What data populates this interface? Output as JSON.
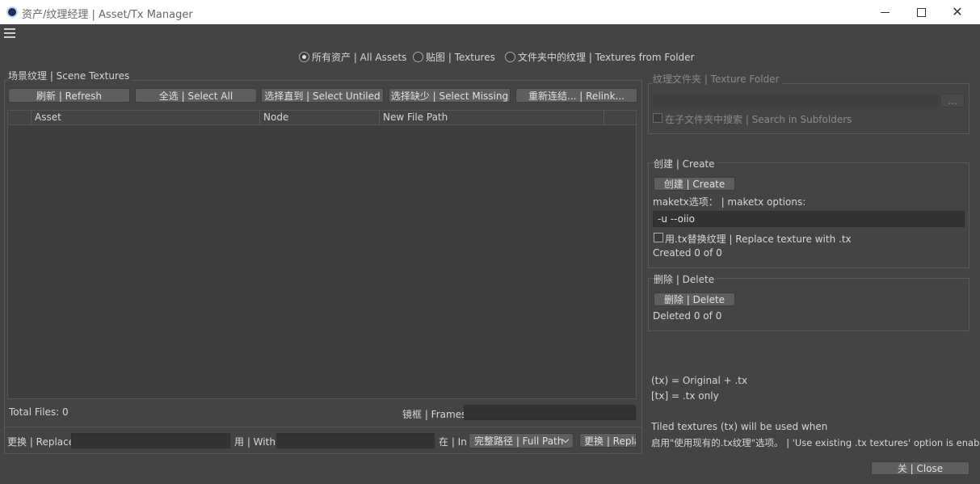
{
  "window": {
    "title": "资产/纹理经理 | Asset/Tx Manager"
  },
  "filters": {
    "all_assets": "所有资产 | All Assets",
    "textures": "贴图 | Textures",
    "textures_from_folder": "文件夹中的纹理 | Textures from Folder",
    "selected": "all_assets"
  },
  "scene": {
    "group_label": "场景纹理 | Scene Textures",
    "buttons": {
      "refresh": "刷新 | Refresh",
      "select_all": "全选 | Select All",
      "select_untiled": "选择直到 | Select Untiled",
      "select_missing": "选择缺少 | Select Missing",
      "relink": "重新连结... | Relink..."
    },
    "columns": [
      "Asset",
      "Node",
      "New File Path"
    ],
    "total_files": "Total Files: 0",
    "frames_label": "镜框 | Frames",
    "frames_value": ""
  },
  "replace_bar": {
    "replace_label": "更换 | Replace",
    "replace_value": "",
    "with_label": "用 | With",
    "with_value": "",
    "in_label": "在 | In",
    "in_selected": "完整路径 | Full Path",
    "replace_button": "更换 | Repla"
  },
  "texture_folder": {
    "group_label": "纹理文件夹 | Texture Folder",
    "path_value": "",
    "browse_button": "...",
    "search_subfolders": "在子文件夹中搜索 | Search in Subfolders"
  },
  "create": {
    "group_label": "创建 | Create",
    "button": "创建 | Create",
    "options_label": "maketx选项： | maketx options:",
    "options_value": "-u --oiio",
    "replace_tx": "用.tx替换纹理 | Replace texture with .tx",
    "status": "Created 0 of 0"
  },
  "delete": {
    "group_label": "删除 | Delete",
    "button": "删除 | Delete",
    "status": "Deleted 0 of 0"
  },
  "legend": {
    "line1": "(tx) = Original + .tx",
    "line2": "[tx] = .tx only",
    "note1": "Tiled textures (tx) will be used when",
    "note2": "启用\"使用现有的.tx纹理\"选项。 | 'Use existing .tx textures' option is enabled."
  },
  "close_button": "关 | Close"
}
